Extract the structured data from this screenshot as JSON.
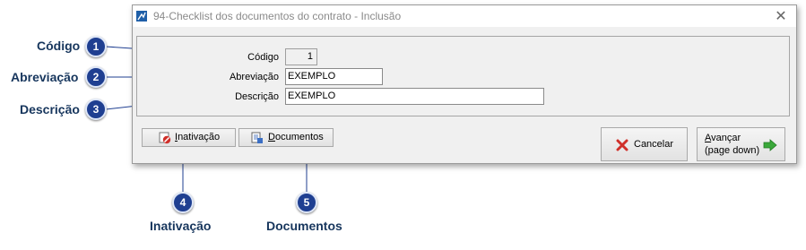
{
  "window": {
    "title": "94-Checklist dos documentos do contrato - Inclusão",
    "close_glyph": "✕"
  },
  "form": {
    "codigo_label": "Código",
    "codigo_value": "1",
    "abreviacao_label": "Abreviação",
    "abreviacao_value": "EXEMPLO",
    "descricao_label": "Descrição",
    "descricao_value": "EXEMPLO"
  },
  "buttons": {
    "inativacao_first": "I",
    "inativacao_rest": "nativação",
    "documentos_first": "D",
    "documentos_rest": "ocumentos",
    "cancelar": "Cancelar",
    "avancar_first": "A",
    "avancar_rest": "vançar",
    "avancar_sub": "(page down)"
  },
  "callouts": [
    {
      "number": "1",
      "label": "Código"
    },
    {
      "number": "2",
      "label": "Abreviação"
    },
    {
      "number": "3",
      "label": "Descrição"
    },
    {
      "number": "4",
      "label": "Inativação"
    },
    {
      "number": "5",
      "label": "Documentos"
    }
  ],
  "colors": {
    "badge": "#1f3f91",
    "callout_text": "#17365d",
    "accent_green": "#3aa83a",
    "cancel_red": "#d0302a"
  },
  "icons": {
    "app": "app-icon",
    "close": "close-icon",
    "inativacao": "deactivate-icon",
    "documentos": "document-icon",
    "cancelar": "cancel-x-icon",
    "avancar": "arrow-right-icon"
  }
}
